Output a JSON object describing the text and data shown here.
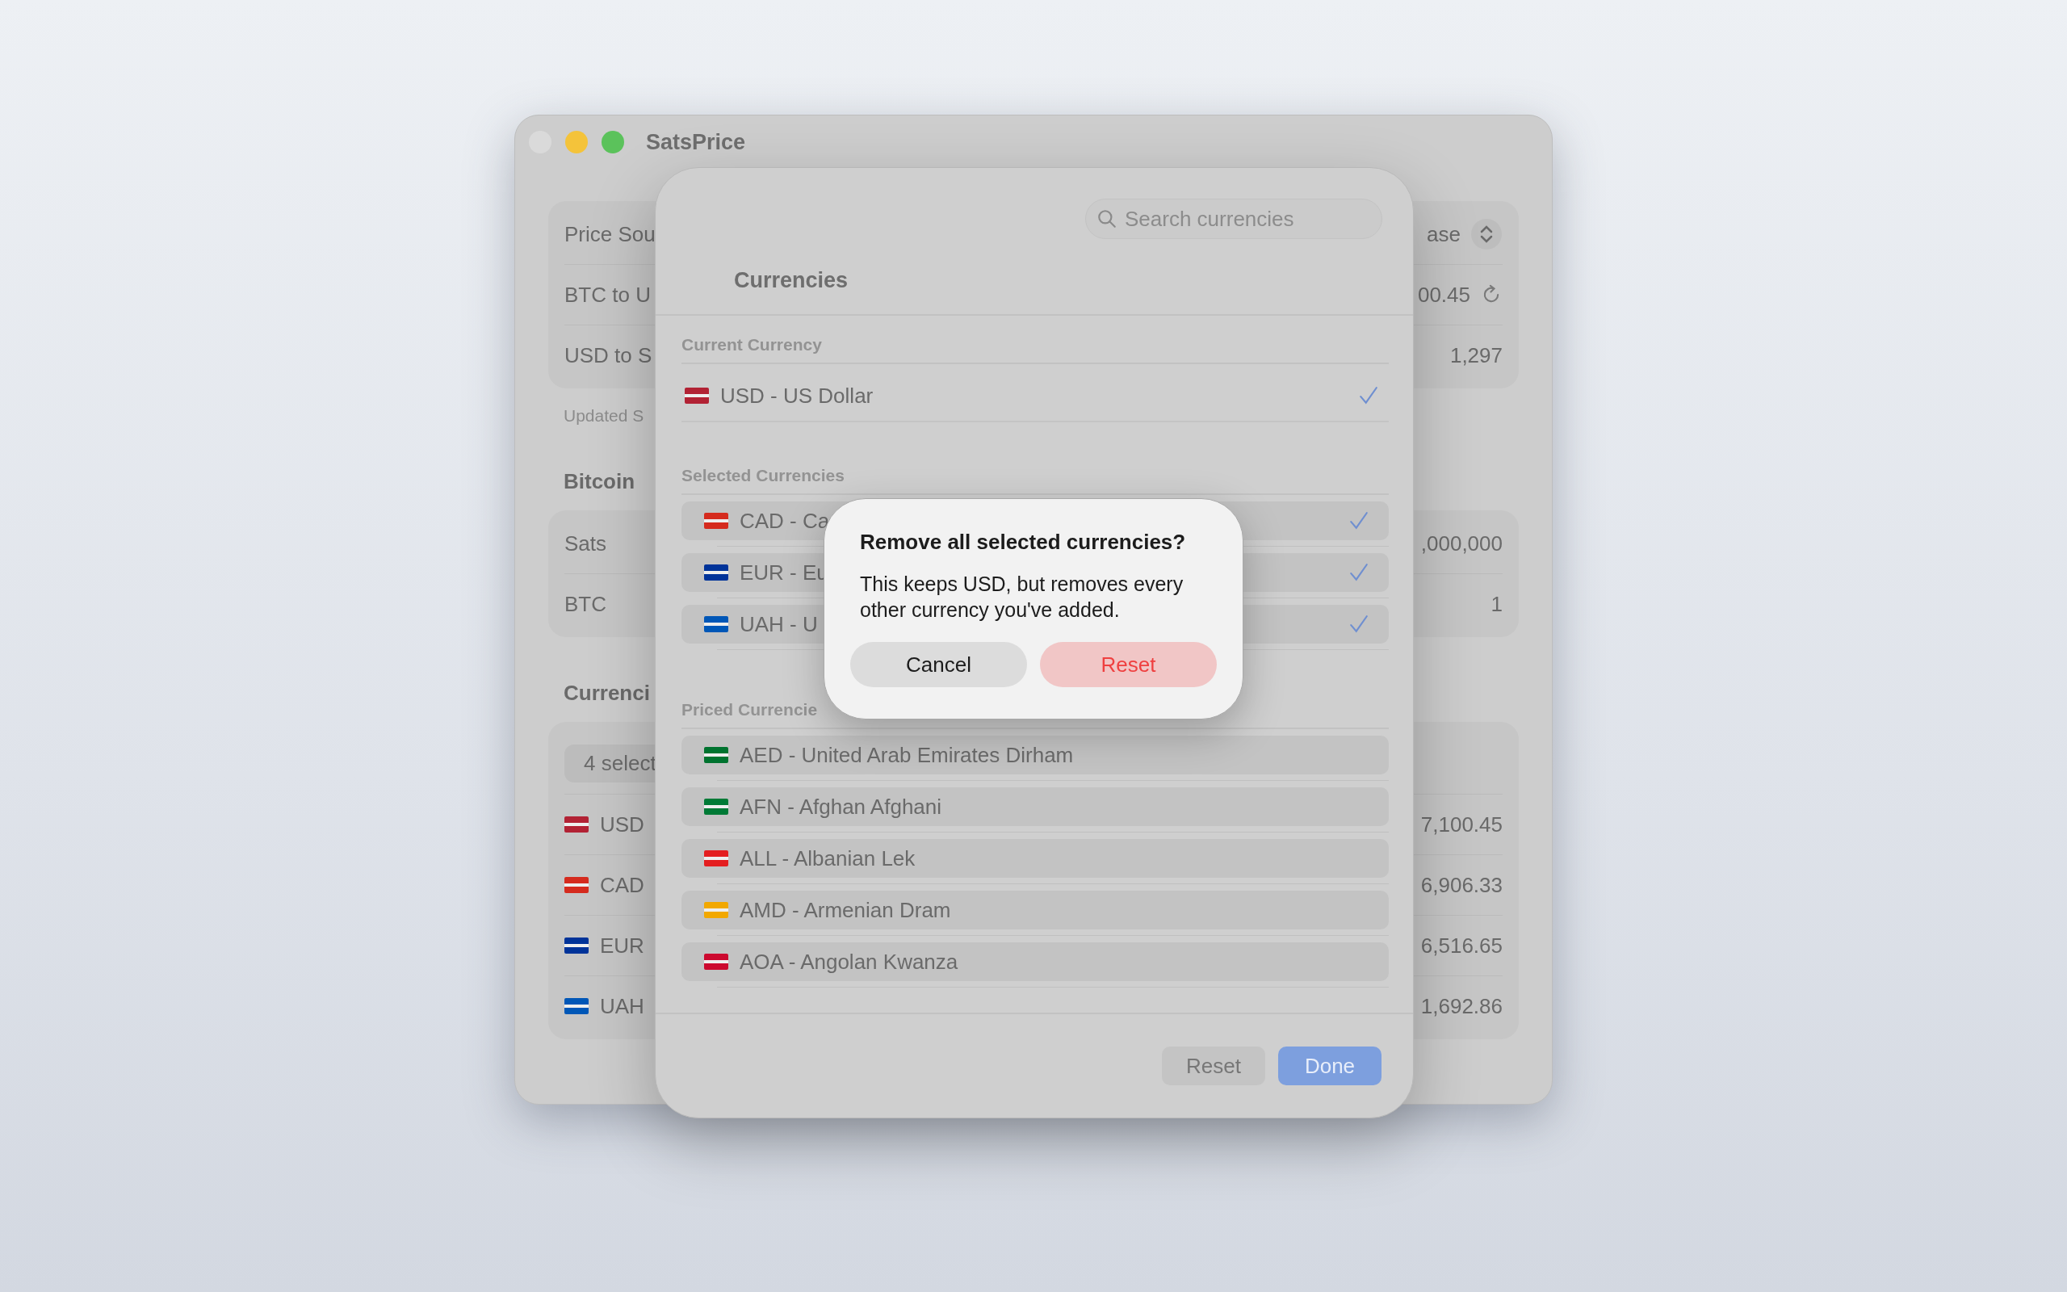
{
  "window": {
    "title": "SatsPrice"
  },
  "price_section": {
    "rows": [
      {
        "label": "Price Sou",
        "value": "ase",
        "kind": "picker"
      },
      {
        "label": "BTC to U",
        "value": "00.45",
        "kind": "refresh"
      },
      {
        "label": "USD to S",
        "value": "1,297",
        "kind": "plain"
      }
    ],
    "note": "Updated S"
  },
  "bitcoin_section": {
    "title": "Bitcoin",
    "rows": [
      {
        "label": "Sats",
        "value": ",000,000"
      },
      {
        "label": "BTC",
        "value": "1"
      }
    ]
  },
  "currencies_section": {
    "title": "Currenci",
    "filter": "4 select",
    "rows": [
      {
        "code": "USD",
        "value": "7,100.45",
        "color": "#b22234"
      },
      {
        "code": "CAD",
        "value": "6,906.33",
        "color": "#d52b1e"
      },
      {
        "code": "EUR",
        "value": "6,516.65",
        "color": "#003399"
      },
      {
        "code": "UAH",
        "value": "1,692.86",
        "color": "#0057b7"
      }
    ]
  },
  "sheet": {
    "search": {
      "placeholder": "Search currencies"
    },
    "title": "Currencies",
    "current": {
      "header": "Current Currency",
      "items": [
        {
          "label": "USD - US Dollar",
          "checked": true,
          "color": "#b22234"
        }
      ]
    },
    "selected": {
      "header": "Selected Currencies",
      "items": [
        {
          "label": "CAD - Ca",
          "checked": true,
          "color": "#d52b1e"
        },
        {
          "label": "EUR - Eu",
          "checked": true,
          "color": "#003399"
        },
        {
          "label": "UAH - U",
          "checked": true,
          "color": "#0057b7"
        }
      ]
    },
    "priced": {
      "header": "Priced Currencie",
      "items": [
        {
          "label": "AED - United Arab Emirates Dirham",
          "checked": false,
          "color": "#00732f"
        },
        {
          "label": "AFN - Afghan Afghani",
          "checked": false,
          "color": "#007a36"
        },
        {
          "label": "ALL - Albanian Lek",
          "checked": false,
          "color": "#e41e20"
        },
        {
          "label": "AMD - Armenian Dram",
          "checked": false,
          "color": "#f2a800"
        },
        {
          "label": "AOA - Angolan Kwanza",
          "checked": false,
          "color": "#cc092f"
        }
      ]
    },
    "buttons": [
      {
        "label": "Reset",
        "kind": "secondary"
      },
      {
        "label": "Done",
        "kind": "primary"
      }
    ]
  },
  "alert": {
    "title": "Remove all selected currencies?",
    "message": "This keeps USD, but removes every other currency you've added.",
    "buttons": [
      {
        "label": "Cancel",
        "kind": "cancel"
      },
      {
        "label": "Reset",
        "kind": "destructive"
      }
    ]
  }
}
